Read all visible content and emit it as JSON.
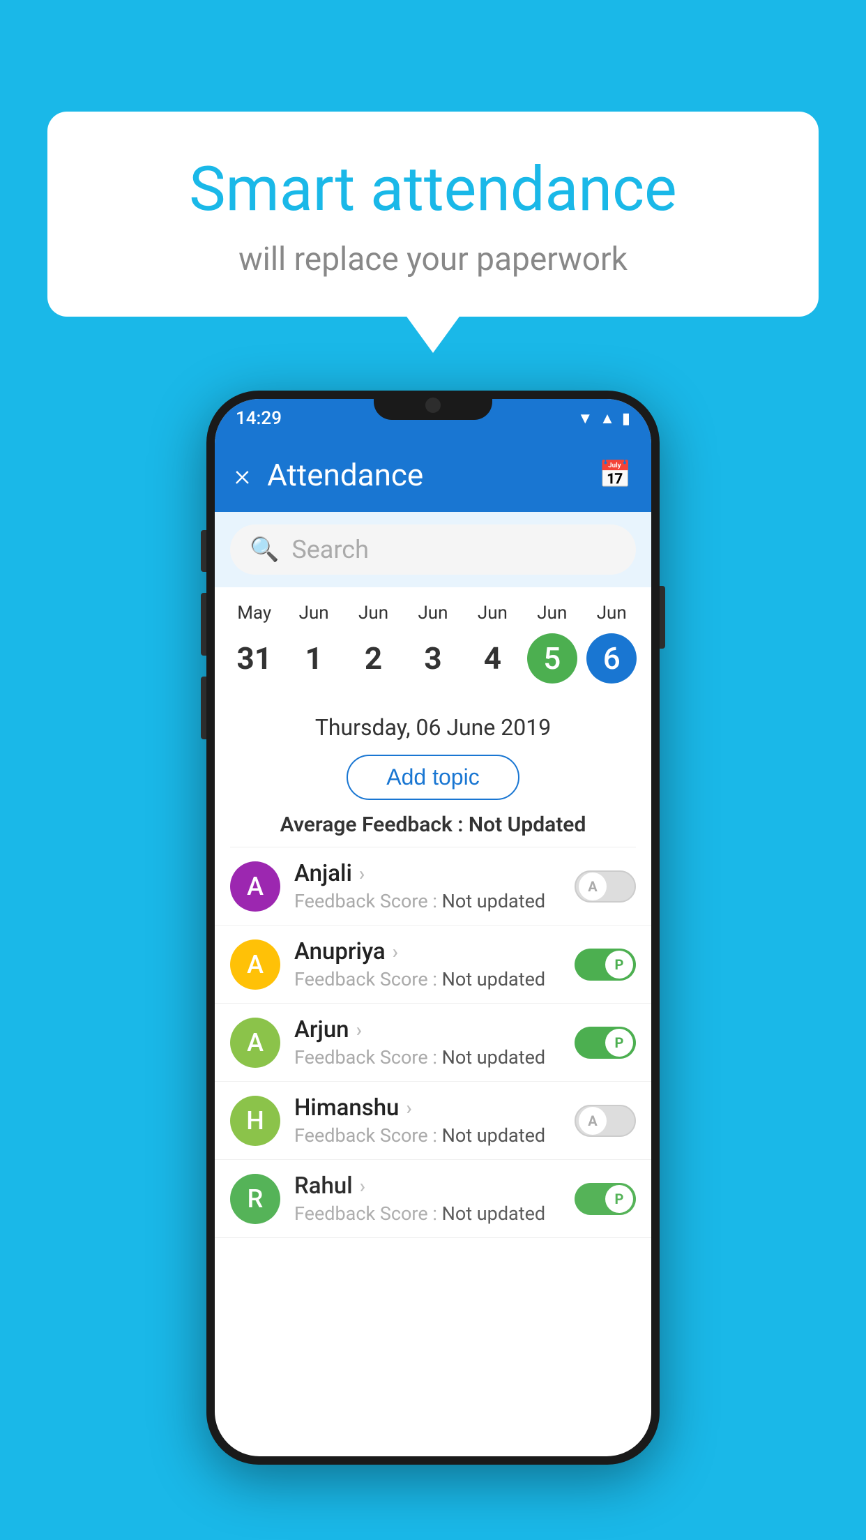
{
  "background_color": "#1ab8e8",
  "speech_bubble": {
    "title": "Smart attendance",
    "subtitle": "will replace your paperwork"
  },
  "status_bar": {
    "time": "14:29",
    "icons": [
      "wifi",
      "signal",
      "battery"
    ]
  },
  "app_bar": {
    "close_label": "×",
    "title": "Attendance",
    "calendar_icon": "📅"
  },
  "search": {
    "placeholder": "Search"
  },
  "dates": [
    {
      "month": "May",
      "day": "31",
      "style": "normal"
    },
    {
      "month": "Jun",
      "day": "1",
      "style": "normal"
    },
    {
      "month": "Jun",
      "day": "2",
      "style": "normal"
    },
    {
      "month": "Jun",
      "day": "3",
      "style": "normal"
    },
    {
      "month": "Jun",
      "day": "4",
      "style": "normal"
    },
    {
      "month": "Jun",
      "day": "5",
      "style": "green"
    },
    {
      "month": "Jun",
      "day": "6",
      "style": "blue"
    }
  ],
  "selected_date_label": "Thursday, 06 June 2019",
  "add_topic_label": "Add topic",
  "avg_feedback_label": "Average Feedback :",
  "avg_feedback_value": "Not Updated",
  "students": [
    {
      "name": "Anjali",
      "avatar_letter": "A",
      "avatar_color": "#9c27b0",
      "feedback_label": "Feedback Score :",
      "feedback_value": "Not updated",
      "attendance": "absent",
      "toggle_letter": "A"
    },
    {
      "name": "Anupriya",
      "avatar_letter": "A",
      "avatar_color": "#ffc107",
      "feedback_label": "Feedback Score :",
      "feedback_value": "Not updated",
      "attendance": "present",
      "toggle_letter": "P"
    },
    {
      "name": "Arjun",
      "avatar_letter": "A",
      "avatar_color": "#8bc34a",
      "feedback_label": "Feedback Score :",
      "feedback_value": "Not updated",
      "attendance": "present",
      "toggle_letter": "P"
    },
    {
      "name": "Himanshu",
      "avatar_letter": "H",
      "avatar_color": "#8bc34a",
      "feedback_label": "Feedback Score :",
      "feedback_value": "Not updated",
      "attendance": "absent",
      "toggle_letter": "A"
    },
    {
      "name": "Rahul",
      "avatar_letter": "R",
      "avatar_color": "#4caf50",
      "feedback_label": "Feedback Score :",
      "feedback_value": "Not updated",
      "attendance": "present",
      "toggle_letter": "P"
    }
  ]
}
